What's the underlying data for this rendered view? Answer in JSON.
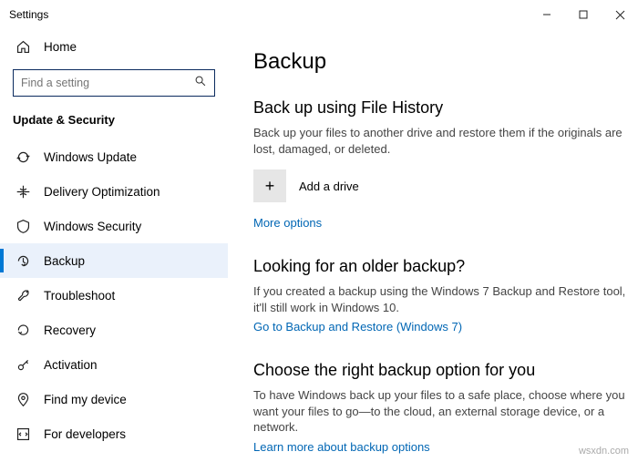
{
  "window": {
    "title": "Settings"
  },
  "home_label": "Home",
  "search": {
    "placeholder": "Find a setting"
  },
  "section_title": "Update & Security",
  "nav": {
    "items": [
      {
        "label": "Windows Update"
      },
      {
        "label": "Delivery Optimization"
      },
      {
        "label": "Windows Security"
      },
      {
        "label": "Backup"
      },
      {
        "label": "Troubleshoot"
      },
      {
        "label": "Recovery"
      },
      {
        "label": "Activation"
      },
      {
        "label": "Find my device"
      },
      {
        "label": "For developers"
      }
    ]
  },
  "page": {
    "title": "Backup",
    "s1": {
      "heading": "Back up using File History",
      "desc": "Back up your files to another drive and restore them if the originals are lost, damaged, or deleted.",
      "add_label": "Add a drive",
      "more_link": "More options"
    },
    "s2": {
      "heading": "Looking for an older backup?",
      "desc": "If you created a backup using the Windows 7 Backup and Restore tool, it'll still work in Windows 10.",
      "link": "Go to Backup and Restore (Windows 7)"
    },
    "s3": {
      "heading": "Choose the right backup option for you",
      "desc": "To have Windows back up your files to a safe place, choose where you want your files to go—to the cloud, an external storage device, or a network.",
      "link": "Learn more about backup options"
    }
  },
  "watermark": "wsxdn.com"
}
